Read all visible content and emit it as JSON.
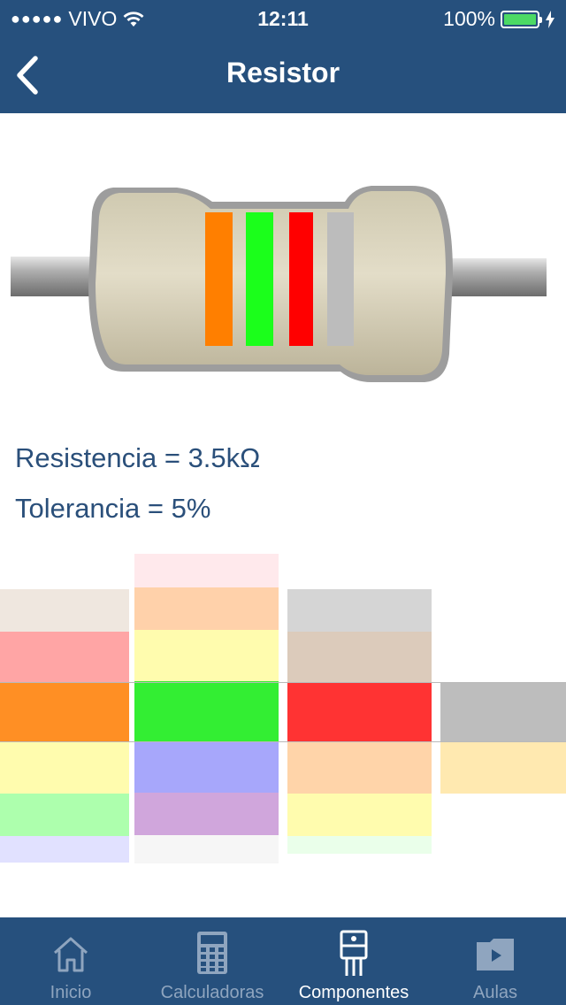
{
  "status_bar": {
    "signal_dots": "●●●●●",
    "carrier": "VIVO",
    "time": "12:11",
    "battery_percent": "100%",
    "battery_level": 1.0
  },
  "nav": {
    "title": "Resistor",
    "back_icon": "chevron-left-icon"
  },
  "resistor": {
    "bands": [
      {
        "name": "band-1",
        "color": "#ff7f00"
      },
      {
        "name": "band-2",
        "color": "#1bff1b"
      },
      {
        "name": "multiplier",
        "color": "#ff0000"
      },
      {
        "name": "tolerance",
        "color": "#bcbcbc"
      }
    ]
  },
  "results": {
    "resistance": "Resistencia = 3.5kΩ",
    "tolerance": "Tolerancia = 5%"
  },
  "picker": {
    "columns": [
      {
        "name": "picker-column-1",
        "selected": "#ff8f24",
        "cells": [
          "#e2d3c4",
          "#ffa5a5",
          "#ff8f24",
          "#fffcae",
          "#adffad",
          "#c9c9ff"
        ]
      },
      {
        "name": "picker-column-2",
        "selected": "#33ee33",
        "cells": [
          "#ffd7dc",
          "#ffd1aa",
          "#fffcae",
          "#33ee33",
          "#a7a7fb",
          "#d0a6dc",
          "#eeeeee"
        ]
      },
      {
        "name": "picker-column-3",
        "selected": "#ff3333",
        "cells": [
          "#b3b3b3",
          "#dccbbb",
          "#ff3333",
          "#ffd4a9",
          "#fffcae",
          "#d9ffd9"
        ]
      },
      {
        "name": "picker-column-4",
        "selected": "#bdbdbd",
        "cells": [
          "#bdbdbd",
          "#ffe9b0"
        ]
      }
    ]
  },
  "tabs": [
    {
      "label": "Inicio",
      "icon": "home-icon",
      "active": false
    },
    {
      "label": "Calculadoras",
      "icon": "calculator-icon",
      "active": false
    },
    {
      "label": "Componentes",
      "icon": "component-icon",
      "active": true
    },
    {
      "label": "Aulas",
      "icon": "video-folder-icon",
      "active": false
    }
  ]
}
